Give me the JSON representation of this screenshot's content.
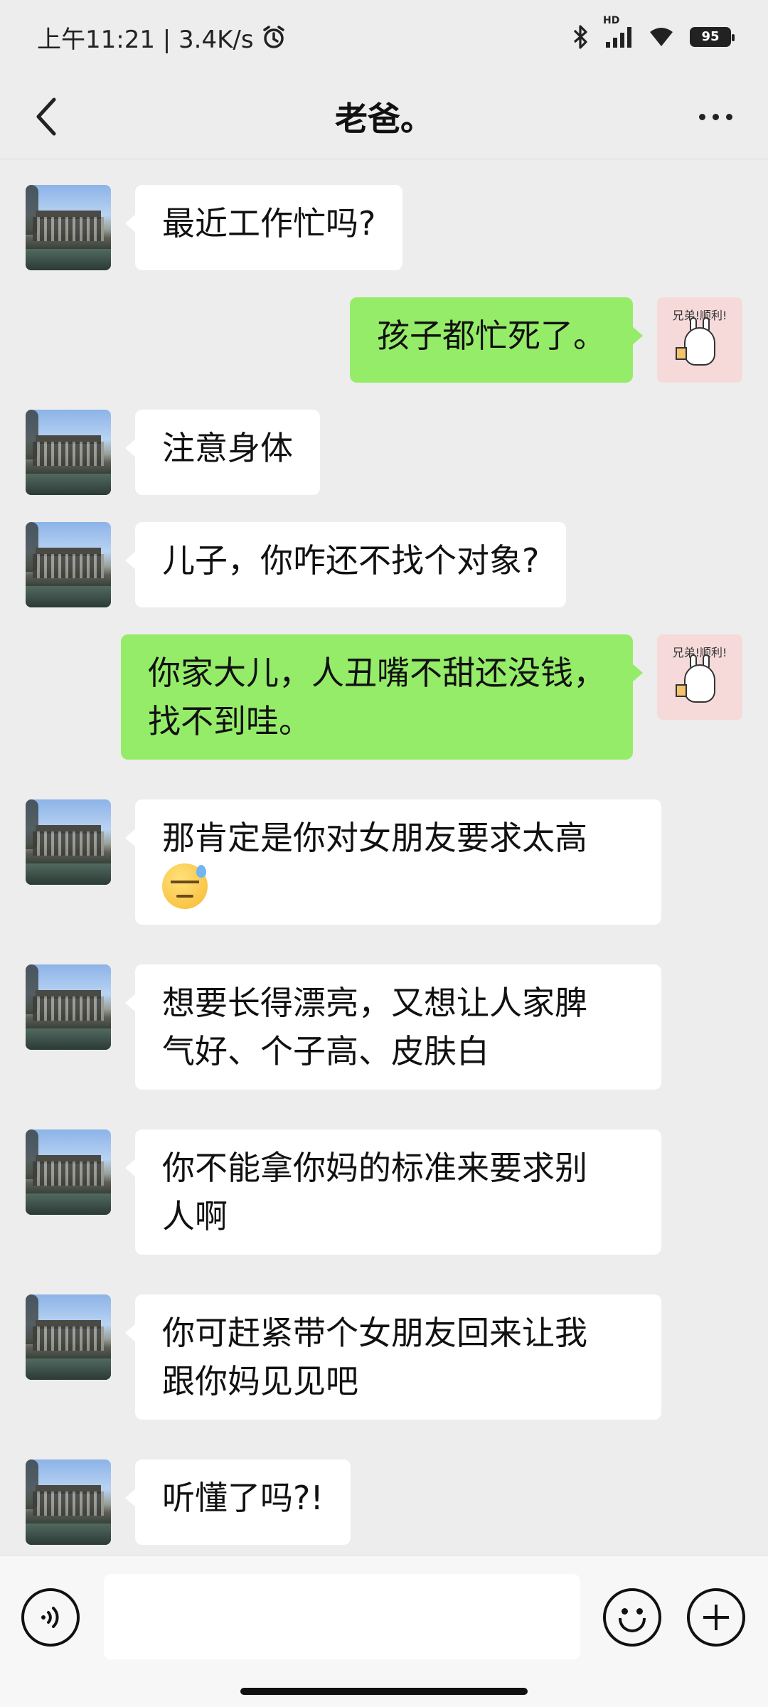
{
  "status_bar": {
    "time_speed": "上午11:21 | 3.4K/s",
    "hd_label": "HD",
    "battery": "95",
    "icons": [
      "alarm-icon",
      "bluetooth-icon",
      "signal-icon",
      "wifi-icon",
      "battery-icon"
    ]
  },
  "header": {
    "title": "老爸。",
    "icons": [
      "back-chevron-icon",
      "more-dots-icon"
    ]
  },
  "colors": {
    "background": "#ededed",
    "incoming_bubble": "#ffffff",
    "outgoing_bubble": "#95ec69",
    "sticker_avatar": "#f6dada"
  },
  "sticker_text": "兄弟!顺利!",
  "messages": [
    {
      "side": "left",
      "text": "最近工作忙吗?"
    },
    {
      "side": "right",
      "text": "孩子都忙死了。"
    },
    {
      "side": "left",
      "text": "注意身体"
    },
    {
      "side": "left",
      "text": "儿子，你咋还不找个对象?"
    },
    {
      "side": "right",
      "line1": "你家大儿，人丑嘴不甜还没钱，",
      "line2": "找不到哇。"
    },
    {
      "side": "left",
      "line1": "那肯定是你对女朋友要求太高",
      "emoji": "sweat-emoji-icon"
    },
    {
      "side": "left",
      "line1": "想要长得漂亮，又想让人家脾",
      "line2": "气好、个子高、皮肤白"
    },
    {
      "side": "left",
      "line1": "你不能拿你妈的标准来要求别",
      "line2": "人啊"
    },
    {
      "side": "left",
      "line1": "你可赶紧带个女朋友回来让我",
      "line2": "跟你妈见见吧"
    },
    {
      "side": "left",
      "text": "听懂了吗?!"
    }
  ],
  "input_bar": {
    "value": "",
    "icons": [
      "voice-icon",
      "emoji-icon",
      "plus-icon"
    ]
  }
}
